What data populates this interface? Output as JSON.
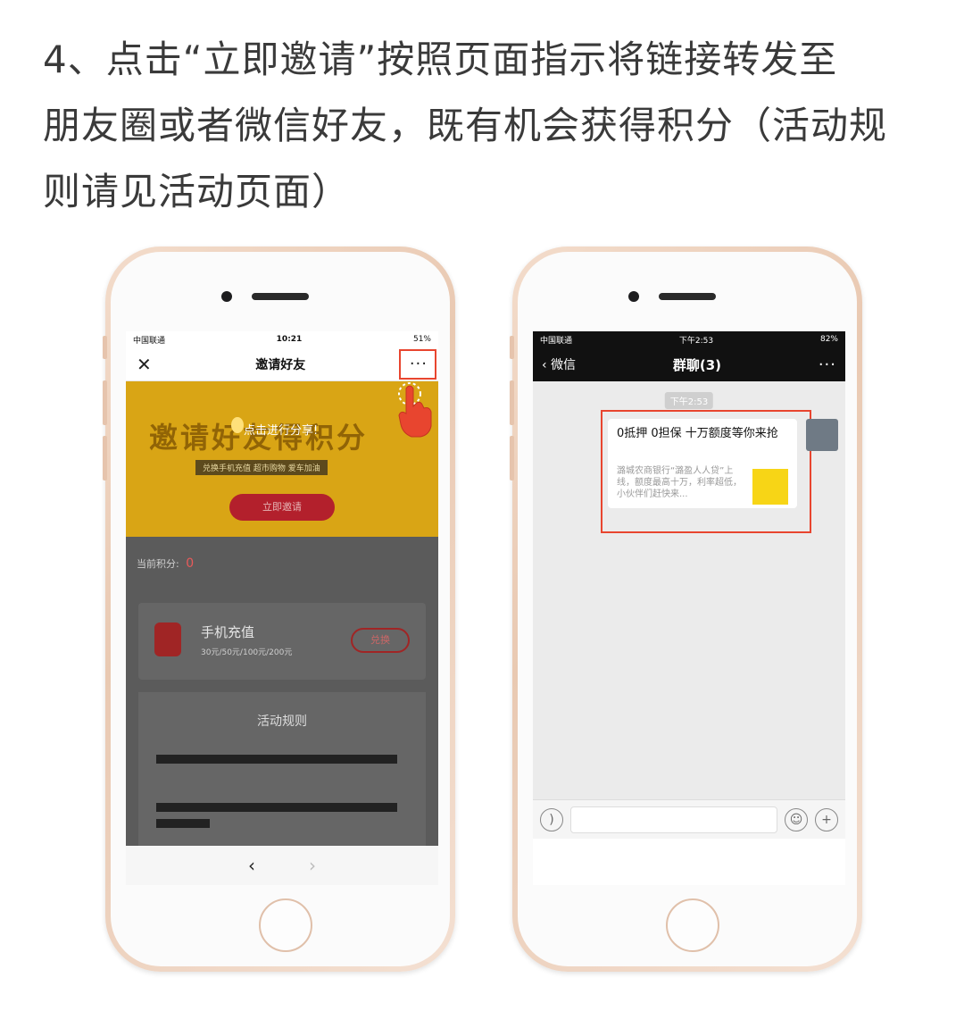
{
  "instruction": {
    "line1": "4、点击“立即邀请”按照页面指示将链接转发至",
    "line2": "朋友圈或者微信好友，既有机会获得积分（活动规",
    "line3": "则请见活动页面）"
  },
  "left_phone": {
    "status": {
      "carrier": "中国联通",
      "time": "10:21",
      "battery": "51%"
    },
    "nav": {
      "close_icon": "close-icon",
      "title": "邀请好友",
      "more": "···"
    },
    "banner": {
      "headline": "邀请好友得积分",
      "share_tip": "点击进行分享!",
      "subtitle": "兑换手机充值  超市购物  爱车加油",
      "invite_button": "立即邀请"
    },
    "points_label": "当前积分:",
    "points_value": "0",
    "reward_card": {
      "title": "手机充值",
      "subtitle": "30元/50元/100元/200元",
      "button": "兑换"
    },
    "rules_title": "活动规则",
    "browser_nav": {
      "back": "‹",
      "forward": "›"
    },
    "highlight_color": "#e8452f"
  },
  "right_phone": {
    "status": {
      "carrier": "中国联通",
      "time": "下午2:53",
      "battery": "82%"
    },
    "nav": {
      "back_label": "微信",
      "title": "群聊(3)",
      "more": "···"
    },
    "timestamp": "下午2:53",
    "message": {
      "title": "0抵押 0担保  十万额度等你来抢",
      "description": "潞城农商银行“潞盈人人贷”上线，额度最高十万，利率超低，小伙伴们赶快来..."
    },
    "highlight_color": "#e8452f"
  }
}
